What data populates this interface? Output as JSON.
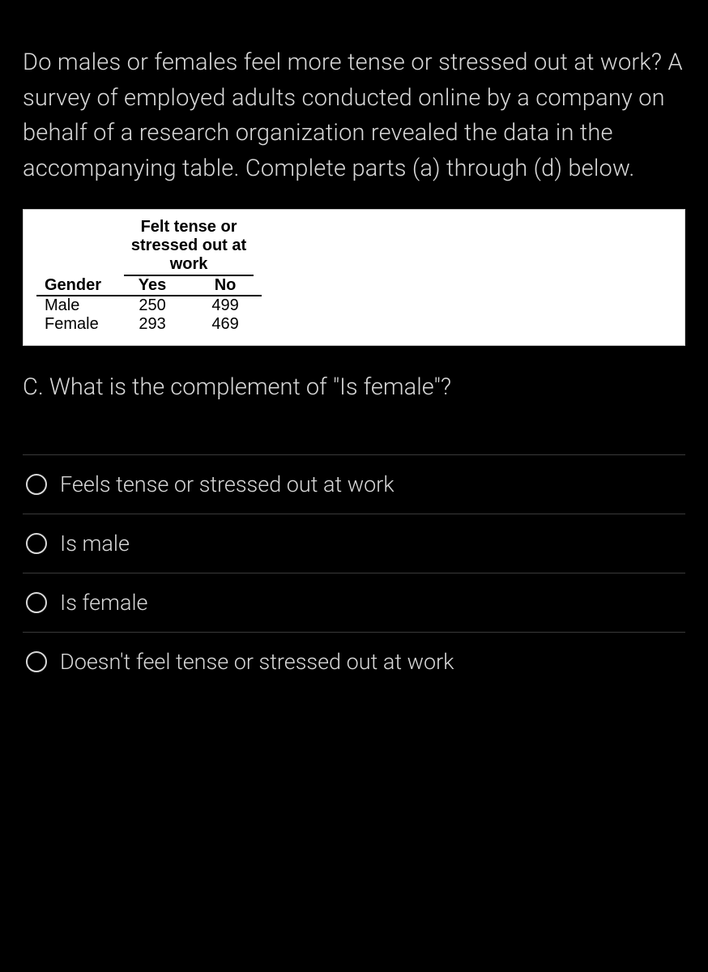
{
  "question": "Do males or females feel more tense or stressed out at work? A survey of employed adults conducted online by a company on behalf of a research organization revealed the data in the accompanying table. Complete parts (a) through (d) below.",
  "table": {
    "super_header": "Felt tense or stressed out at work",
    "row_header": "Gender",
    "col1": "Yes",
    "col2": "No",
    "rows": [
      {
        "label": "Male",
        "yes": "250",
        "no": "499"
      },
      {
        "label": "Female",
        "yes": "293",
        "no": "469"
      }
    ]
  },
  "part_question": "C. What is the complement of \"Is female\"?",
  "options": [
    "Feels tense or stressed out at work",
    "Is male",
    "Is female",
    "Doesn't feel tense or stressed out at work"
  ]
}
